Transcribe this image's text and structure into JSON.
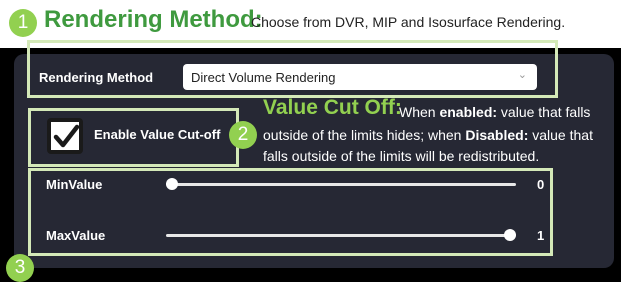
{
  "header": {
    "badge_1": "1",
    "title": "Rendering Method",
    "title_colon": ":",
    "description": "Choose from DVR, MIP and Isosurface Rendering."
  },
  "rendering": {
    "label": "Rendering Method",
    "selected_value": "Direct Volume Rendering",
    "chevron_icon": "chevron-down-icon"
  },
  "cutoff": {
    "checkbox_checked": true,
    "checkbox_icon": "checkmark-icon",
    "label": "Enable  Value Cut-off"
  },
  "callout_2": {
    "badge": "2",
    "title": "Value Cut Off",
    "title_colon": ":",
    "line1_prefix": "When ",
    "line1_bold": "enabled:",
    "line1_suffix": " value that falls",
    "line2_prefix": "outside of the limits hides; when ",
    "line2_bold": "Disabled:",
    "line2_suffix": " value that",
    "line3": "falls outside of the limits will be redistributed."
  },
  "sliders": {
    "min": {
      "label": "MinValue",
      "value": "0",
      "level": 0
    },
    "max": {
      "label": "MaxValue",
      "value": "1",
      "level": 1
    }
  },
  "badge_3": "3",
  "colors": {
    "accent_green": "#92d050",
    "title_green": "#3f9a3f",
    "panel_bg": "#262834",
    "frame_border": "#d4e9b8"
  }
}
